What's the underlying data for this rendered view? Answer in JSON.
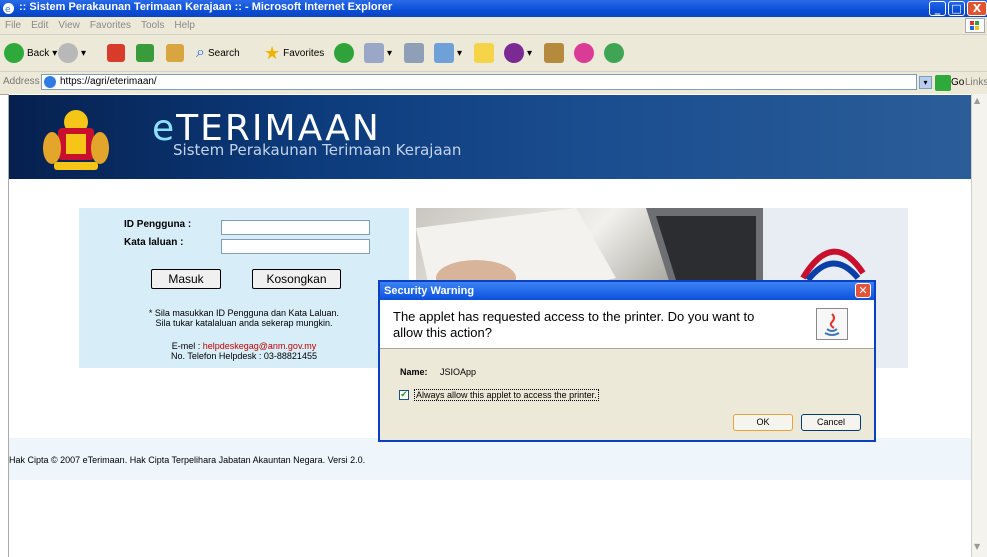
{
  "window": {
    "title": ":: Sistem Perakaunan Terimaan Kerajaan :: - Microsoft Internet Explorer",
    "minimize": "_",
    "maximize": "□",
    "close": "X"
  },
  "menu": [
    "File",
    "Edit",
    "View",
    "Favorites",
    "Tools",
    "Help"
  ],
  "toolbar": {
    "back": "Back",
    "search": "Search",
    "favorites": "Favorites"
  },
  "address": {
    "label": "Address",
    "url": "https://agri/eterimaan/",
    "go": "Go",
    "links": "Links"
  },
  "banner": {
    "brand_prefix": "e",
    "brand_rest": "TERIMAAN",
    "subtitle": "Sistem Perakaunan Terimaan Kerajaan"
  },
  "login": {
    "user_label": "ID Pengguna :",
    "password_label": "Kata laluan :",
    "user_value": "",
    "password_value": "",
    "submit_label": "Masuk",
    "reset_label": "Kosongkan",
    "note_line1": "* Sila masukkan ID Pengguna dan Kata Laluan.",
    "note_line2": "Sila tukar katalaluan anda sekerap mungkin.",
    "email_prefix": "E-mel : ",
    "email": "helpdeskegag@anm.gov.my",
    "phone": "No. Telefon Helpdesk : 03-88821455"
  },
  "footer": {
    "text": "Hak Cipta © 2007 eTerimaan. Hak Cipta Terpelihara Jabatan Akauntan Negara. Versi 2.0."
  },
  "dialog": {
    "title": "Security Warning",
    "message": "The applet has requested access to the printer.  Do you want to allow this action?",
    "name_label": "Name:",
    "name_value": "JSIOApp",
    "checkbox_checked": true,
    "checkbox_label": "Always allow this applet to access the printer.",
    "ok_label": "OK",
    "cancel_label": "Cancel"
  }
}
